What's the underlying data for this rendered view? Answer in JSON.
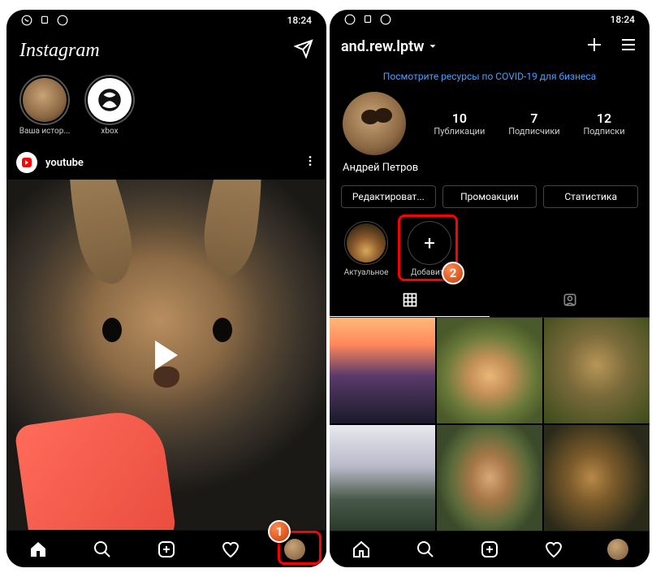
{
  "statusbar": {
    "time": "18:24"
  },
  "feed": {
    "brand": "Instagram",
    "stories": [
      {
        "label": "Ваша истор..."
      },
      {
        "label": "xbox"
      }
    ],
    "post_user": "youtube"
  },
  "profile": {
    "username": "and.rew.lptw",
    "covid_link": "Посмотрите ресурсы по COVID-19 для бизнеса",
    "stats": {
      "posts_num": "10",
      "posts_lbl": "Публикации",
      "followers_num": "7",
      "followers_lbl": "Подписчики",
      "following_num": "12",
      "following_lbl": "Подписки"
    },
    "display_name": "Андрей Петров",
    "buttons": {
      "edit": "Редактироват...",
      "promo": "Промоакции",
      "stats": "Статистика"
    },
    "highlights": {
      "featured": "Актуальное",
      "add": "Добавить"
    }
  },
  "annotations": {
    "step1": "1",
    "step2": "2"
  }
}
